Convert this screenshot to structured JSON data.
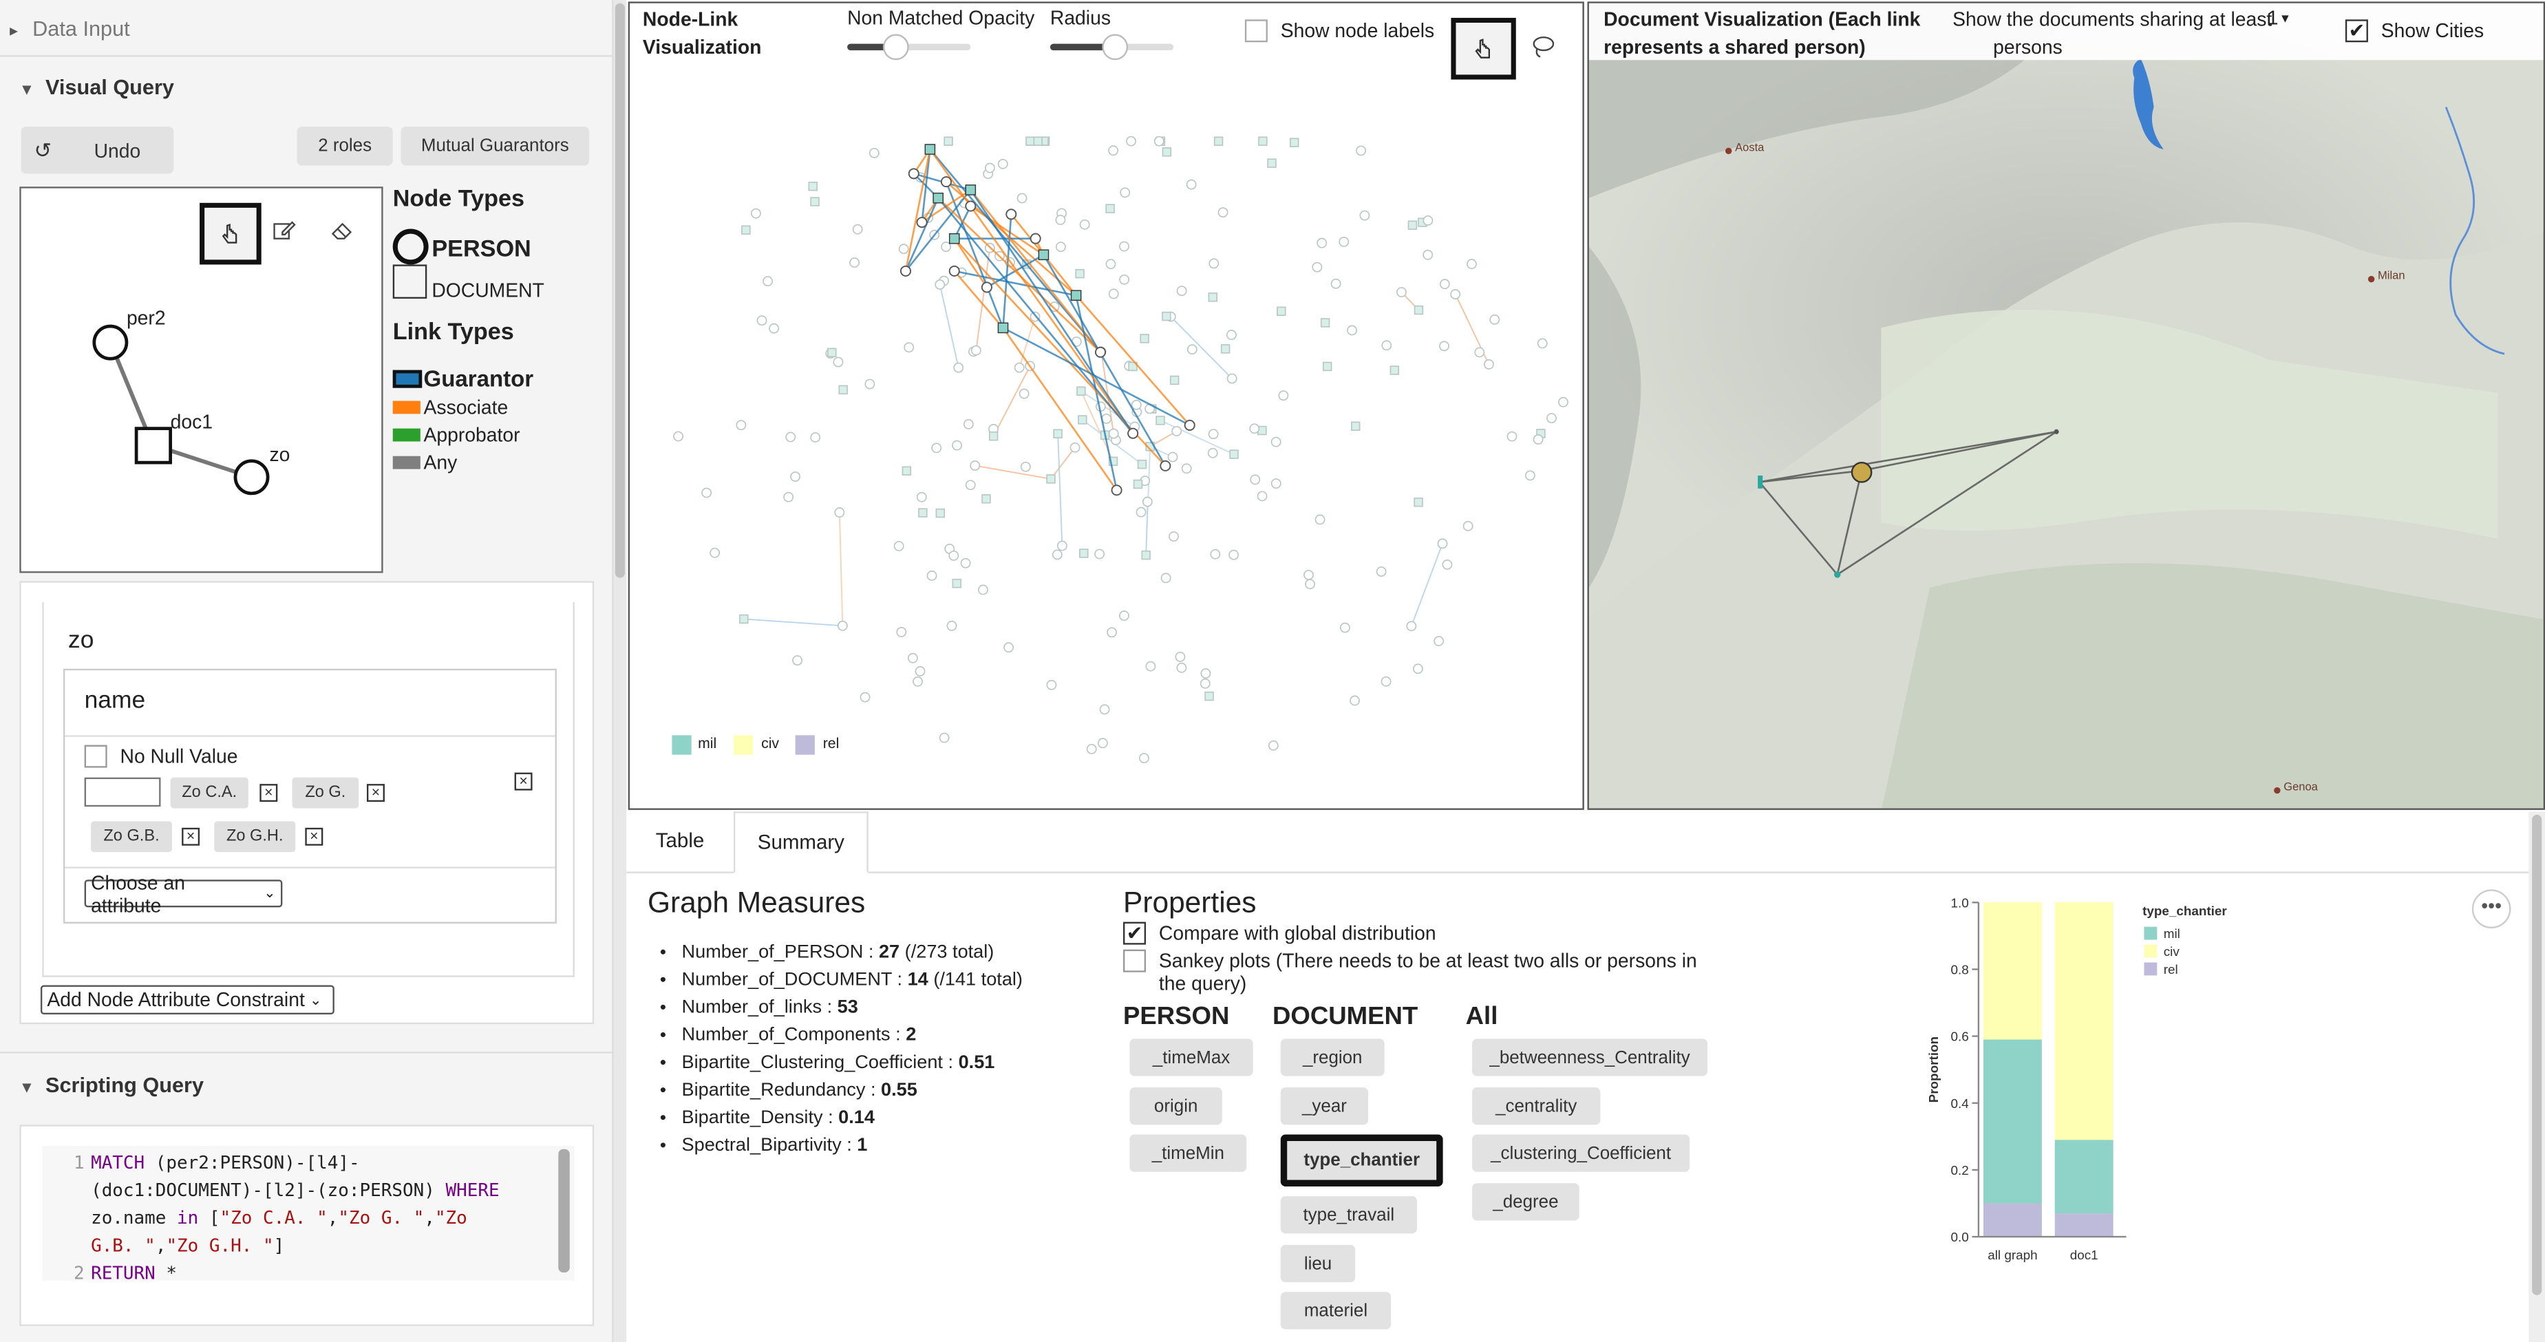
{
  "left": {
    "data_input": "Data Input",
    "visual_query": "Visual Query",
    "undo": "Undo",
    "roles_btn": "2 roles",
    "mutual_btn": "Mutual Guarantors",
    "node_types_title": "Node Types",
    "node_type_person": "PERSON",
    "node_type_document": "DOCUMENT",
    "link_types_title": "Link Types",
    "link_types": [
      {
        "label": "Guarantor",
        "color": "#1f77b4"
      },
      {
        "label": "Associate",
        "color": "#ff7f0e"
      },
      {
        "label": "Approbator",
        "color": "#2ca02c"
      },
      {
        "label": "Any",
        "color": "#7f7f7f"
      }
    ],
    "graph_nodes": {
      "per2": "per2",
      "doc1": "doc1",
      "zo": "zo"
    },
    "constraint": {
      "node": "zo",
      "attribute": "name",
      "no_null": "No Null Value",
      "input_value": "",
      "chips": [
        "Zo C.A.",
        "Zo G.",
        "Zo G.B.",
        "Zo G.H."
      ],
      "choose_attr": "Choose an attribute"
    },
    "add_constraint": "Add Node Attribute Constraint",
    "scripting_query": "Scripting Query",
    "code_line_numbers": [
      "1",
      "2"
    ]
  },
  "nodelink": {
    "title_line1": "Node-Link",
    "title_line2": "Visualization",
    "opacity_label": "Non Matched Opacity",
    "radius_label": "Radius",
    "show_labels": "Show node labels",
    "legend": [
      {
        "label": "mil",
        "color": "#8fd3c8"
      },
      {
        "label": "civ",
        "color": "#ffffb3"
      },
      {
        "label": "rel",
        "color": "#bebada"
      }
    ]
  },
  "docvis": {
    "title_line1": "Document Visualization (Each link",
    "title_line2": "represents a shared person)",
    "share_line1": "Show the documents sharing at least",
    "share_line2": "persons",
    "share_value": "1",
    "show_cities": "Show Cities",
    "cities": [
      "Aosta",
      "Milan",
      "Genoa"
    ]
  },
  "tabs": {
    "table": "Table",
    "summary": "Summary"
  },
  "graph_measures": {
    "title": "Graph Measures",
    "items": [
      {
        "k": "Number_of_PERSON",
        "v": "27",
        "x": " (/273 total)"
      },
      {
        "k": "Number_of_DOCUMENT",
        "v": "14",
        "x": " (/141 total)"
      },
      {
        "k": "Number_of_links",
        "v": "53",
        "x": ""
      },
      {
        "k": "Number_of_Components",
        "v": "2",
        "x": ""
      },
      {
        "k": "Bipartite_Clustering_Coefficient",
        "v": "0.51",
        "x": ""
      },
      {
        "k": "Bipartite_Redundancy",
        "v": "0.55",
        "x": ""
      },
      {
        "k": "Bipartite_Density",
        "v": "0.14",
        "x": ""
      },
      {
        "k": "Spectral_Bipartivity",
        "v": "1",
        "x": ""
      }
    ]
  },
  "properties": {
    "title": "Properties",
    "compare": "Compare with global distribution",
    "sankey_line1": "Sankey plots (There needs to be at least two alls or persons in",
    "sankey_line2": "the query)",
    "person_header": "PERSON",
    "document_header": "DOCUMENT",
    "all_header": "All",
    "person_props": [
      "_timeMax",
      "origin",
      "_timeMin"
    ],
    "document_props": [
      "_region",
      "_year",
      "type_chantier",
      "type_travail",
      "lieu",
      "materiel"
    ],
    "all_props": [
      "_betweenness_Centrality",
      "_centrality",
      "_clustering_Coefficient",
      "_degree"
    ]
  },
  "chart_data": {
    "type": "bar",
    "categories": [
      "all graph",
      "doc1"
    ],
    "series": [
      {
        "name": "rel",
        "values": [
          0.1,
          0.07
        ]
      },
      {
        "name": "mil",
        "values": [
          0.49,
          0.22
        ]
      },
      {
        "name": "civ",
        "values": [
          0.41,
          0.71
        ]
      }
    ],
    "colors": {
      "mil": "#8fd3c8",
      "civ": "#ffffb3",
      "rel": "#bebada"
    },
    "legend_title": "type_chantier",
    "ylabel": "Proportion",
    "ylim": [
      0,
      1
    ],
    "yticks": [
      "0.0",
      "0.2",
      "0.4",
      "0.6",
      "0.8",
      "1.0"
    ]
  }
}
